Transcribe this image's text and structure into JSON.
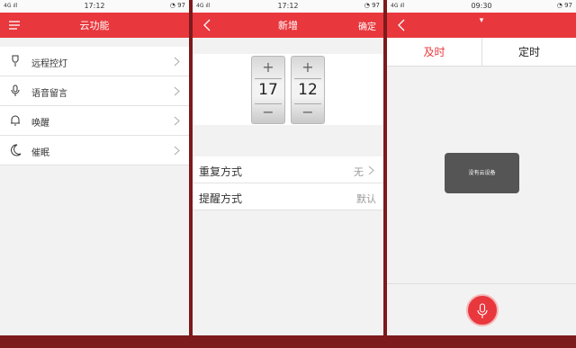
{
  "screen1": {
    "status": {
      "signal": "4G ıll",
      "time": "17:12",
      "right": "◔ 97"
    },
    "title": "云功能",
    "menu": [
      {
        "label": "远程控灯",
        "icon": "lamp-icon"
      },
      {
        "label": "语音留言",
        "icon": "microphone-icon"
      },
      {
        "label": "唤醒",
        "icon": "bell-icon"
      },
      {
        "label": "催眠",
        "icon": "moon-icon"
      }
    ]
  },
  "screen2": {
    "status": {
      "signal": "4G ıll",
      "time": "17:12",
      "right": "◔ 97"
    },
    "title": "新增",
    "confirm": "确定",
    "picker": {
      "hour": "17",
      "minute": "12",
      "plus": "+",
      "minus": "−"
    },
    "settings": [
      {
        "label": "重复方式",
        "value": "无"
      },
      {
        "label": "提醒方式",
        "value": "默认"
      }
    ]
  },
  "screen3": {
    "status": {
      "signal": "4G ıll",
      "time": "09:30",
      "right": "◔ 97"
    },
    "dropdown": "▾",
    "tabs": [
      {
        "label": "及时"
      },
      {
        "label": "定时"
      }
    ],
    "toast": "没有云设备"
  },
  "colors": {
    "accent": "#e8383d",
    "frame": "#7d1a1c"
  }
}
